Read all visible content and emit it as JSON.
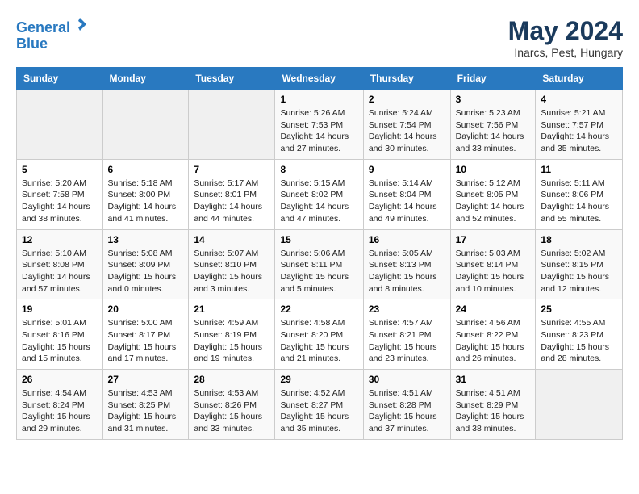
{
  "header": {
    "logo_line1": "General",
    "logo_line2": "Blue",
    "title": "May 2024",
    "subtitle": "Inarcs, Pest, Hungary"
  },
  "weekdays": [
    "Sunday",
    "Monday",
    "Tuesday",
    "Wednesday",
    "Thursday",
    "Friday",
    "Saturday"
  ],
  "weeks": [
    [
      {
        "day": "",
        "sunrise": "",
        "sunset": "",
        "daylight": ""
      },
      {
        "day": "",
        "sunrise": "",
        "sunset": "",
        "daylight": ""
      },
      {
        "day": "",
        "sunrise": "",
        "sunset": "",
        "daylight": ""
      },
      {
        "day": "1",
        "sunrise": "Sunrise: 5:26 AM",
        "sunset": "Sunset: 7:53 PM",
        "daylight": "Daylight: 14 hours and 27 minutes."
      },
      {
        "day": "2",
        "sunrise": "Sunrise: 5:24 AM",
        "sunset": "Sunset: 7:54 PM",
        "daylight": "Daylight: 14 hours and 30 minutes."
      },
      {
        "day": "3",
        "sunrise": "Sunrise: 5:23 AM",
        "sunset": "Sunset: 7:56 PM",
        "daylight": "Daylight: 14 hours and 33 minutes."
      },
      {
        "day": "4",
        "sunrise": "Sunrise: 5:21 AM",
        "sunset": "Sunset: 7:57 PM",
        "daylight": "Daylight: 14 hours and 35 minutes."
      }
    ],
    [
      {
        "day": "5",
        "sunrise": "Sunrise: 5:20 AM",
        "sunset": "Sunset: 7:58 PM",
        "daylight": "Daylight: 14 hours and 38 minutes."
      },
      {
        "day": "6",
        "sunrise": "Sunrise: 5:18 AM",
        "sunset": "Sunset: 8:00 PM",
        "daylight": "Daylight: 14 hours and 41 minutes."
      },
      {
        "day": "7",
        "sunrise": "Sunrise: 5:17 AM",
        "sunset": "Sunset: 8:01 PM",
        "daylight": "Daylight: 14 hours and 44 minutes."
      },
      {
        "day": "8",
        "sunrise": "Sunrise: 5:15 AM",
        "sunset": "Sunset: 8:02 PM",
        "daylight": "Daylight: 14 hours and 47 minutes."
      },
      {
        "day": "9",
        "sunrise": "Sunrise: 5:14 AM",
        "sunset": "Sunset: 8:04 PM",
        "daylight": "Daylight: 14 hours and 49 minutes."
      },
      {
        "day": "10",
        "sunrise": "Sunrise: 5:12 AM",
        "sunset": "Sunset: 8:05 PM",
        "daylight": "Daylight: 14 hours and 52 minutes."
      },
      {
        "day": "11",
        "sunrise": "Sunrise: 5:11 AM",
        "sunset": "Sunset: 8:06 PM",
        "daylight": "Daylight: 14 hours and 55 minutes."
      }
    ],
    [
      {
        "day": "12",
        "sunrise": "Sunrise: 5:10 AM",
        "sunset": "Sunset: 8:08 PM",
        "daylight": "Daylight: 14 hours and 57 minutes."
      },
      {
        "day": "13",
        "sunrise": "Sunrise: 5:08 AM",
        "sunset": "Sunset: 8:09 PM",
        "daylight": "Daylight: 15 hours and 0 minutes."
      },
      {
        "day": "14",
        "sunrise": "Sunrise: 5:07 AM",
        "sunset": "Sunset: 8:10 PM",
        "daylight": "Daylight: 15 hours and 3 minutes."
      },
      {
        "day": "15",
        "sunrise": "Sunrise: 5:06 AM",
        "sunset": "Sunset: 8:11 PM",
        "daylight": "Daylight: 15 hours and 5 minutes."
      },
      {
        "day": "16",
        "sunrise": "Sunrise: 5:05 AM",
        "sunset": "Sunset: 8:13 PM",
        "daylight": "Daylight: 15 hours and 8 minutes."
      },
      {
        "day": "17",
        "sunrise": "Sunrise: 5:03 AM",
        "sunset": "Sunset: 8:14 PM",
        "daylight": "Daylight: 15 hours and 10 minutes."
      },
      {
        "day": "18",
        "sunrise": "Sunrise: 5:02 AM",
        "sunset": "Sunset: 8:15 PM",
        "daylight": "Daylight: 15 hours and 12 minutes."
      }
    ],
    [
      {
        "day": "19",
        "sunrise": "Sunrise: 5:01 AM",
        "sunset": "Sunset: 8:16 PM",
        "daylight": "Daylight: 15 hours and 15 minutes."
      },
      {
        "day": "20",
        "sunrise": "Sunrise: 5:00 AM",
        "sunset": "Sunset: 8:17 PM",
        "daylight": "Daylight: 15 hours and 17 minutes."
      },
      {
        "day": "21",
        "sunrise": "Sunrise: 4:59 AM",
        "sunset": "Sunset: 8:19 PM",
        "daylight": "Daylight: 15 hours and 19 minutes."
      },
      {
        "day": "22",
        "sunrise": "Sunrise: 4:58 AM",
        "sunset": "Sunset: 8:20 PM",
        "daylight": "Daylight: 15 hours and 21 minutes."
      },
      {
        "day": "23",
        "sunrise": "Sunrise: 4:57 AM",
        "sunset": "Sunset: 8:21 PM",
        "daylight": "Daylight: 15 hours and 23 minutes."
      },
      {
        "day": "24",
        "sunrise": "Sunrise: 4:56 AM",
        "sunset": "Sunset: 8:22 PM",
        "daylight": "Daylight: 15 hours and 26 minutes."
      },
      {
        "day": "25",
        "sunrise": "Sunrise: 4:55 AM",
        "sunset": "Sunset: 8:23 PM",
        "daylight": "Daylight: 15 hours and 28 minutes."
      }
    ],
    [
      {
        "day": "26",
        "sunrise": "Sunrise: 4:54 AM",
        "sunset": "Sunset: 8:24 PM",
        "daylight": "Daylight: 15 hours and 29 minutes."
      },
      {
        "day": "27",
        "sunrise": "Sunrise: 4:53 AM",
        "sunset": "Sunset: 8:25 PM",
        "daylight": "Daylight: 15 hours and 31 minutes."
      },
      {
        "day": "28",
        "sunrise": "Sunrise: 4:53 AM",
        "sunset": "Sunset: 8:26 PM",
        "daylight": "Daylight: 15 hours and 33 minutes."
      },
      {
        "day": "29",
        "sunrise": "Sunrise: 4:52 AM",
        "sunset": "Sunset: 8:27 PM",
        "daylight": "Daylight: 15 hours and 35 minutes."
      },
      {
        "day": "30",
        "sunrise": "Sunrise: 4:51 AM",
        "sunset": "Sunset: 8:28 PM",
        "daylight": "Daylight: 15 hours and 37 minutes."
      },
      {
        "day": "31",
        "sunrise": "Sunrise: 4:51 AM",
        "sunset": "Sunset: 8:29 PM",
        "daylight": "Daylight: 15 hours and 38 minutes."
      },
      {
        "day": "",
        "sunrise": "",
        "sunset": "",
        "daylight": ""
      }
    ]
  ]
}
